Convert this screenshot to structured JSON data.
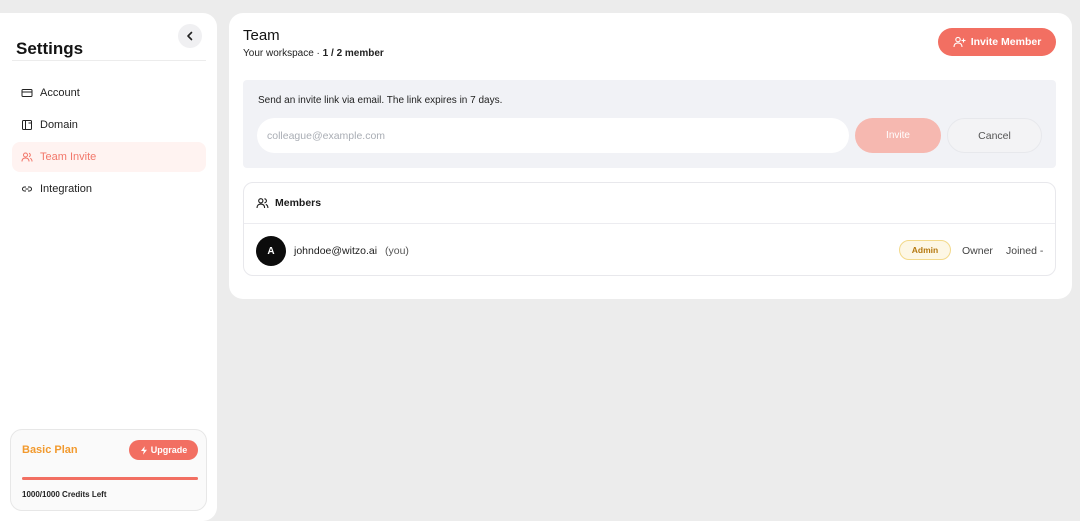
{
  "sidebar": {
    "title": "Settings",
    "items": [
      {
        "label": "Account",
        "icon": "card-icon",
        "active": false
      },
      {
        "label": "Domain",
        "icon": "domain-icon",
        "active": false
      },
      {
        "label": "Team Invite",
        "icon": "users-icon",
        "active": true
      },
      {
        "label": "Integration",
        "icon": "link-icon",
        "active": false
      }
    ],
    "plan": {
      "name": "Basic Plan",
      "upgrade_label": "Upgrade",
      "credits_text": "1000/1000 Credits Left",
      "credits_fraction": 1.0
    }
  },
  "header": {
    "title": "Team",
    "subtitle_prefix": "Your workspace · ",
    "subtitle_count": "1 / 2 member",
    "invite_member_label": "Invite Member"
  },
  "invite": {
    "description": "Send an invite link via email. The link expires in 7 days.",
    "email_placeholder": "colleague@example.com",
    "email_value": "",
    "invite_label": "Invite",
    "cancel_label": "Cancel"
  },
  "members": {
    "heading": "Members",
    "rows": [
      {
        "avatar_letter": "A",
        "email": "johndoe@witzo.ai",
        "self_tag": "(you)",
        "role_badge": "Admin",
        "role": "Owner",
        "joined": "Joined -"
      }
    ]
  },
  "colors": {
    "accent": "#f26f62",
    "accent_disabled": "#f6b8b0",
    "plan_name": "#f29a2e",
    "badge_bg": "#fdf7e5",
    "badge_text": "#b5780f"
  }
}
